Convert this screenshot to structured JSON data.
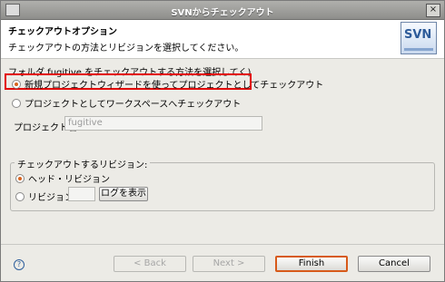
{
  "window": {
    "title": "SVNからチェックアウト",
    "close_glyph": "×"
  },
  "header": {
    "title": "チェックアウトオプション",
    "description": "チェックアウトの方法とリビジョンを選択してください。",
    "logo_text": "SVN"
  },
  "checkout_method": {
    "prompt": "フォルダ fugitive をチェックアウトする方法を選択してく)",
    "options": [
      {
        "label": "新規プロジェクトウィザードを使ってプロジェクトとしてチェックアウト",
        "selected": true
      },
      {
        "label": "プロジェクトとしてワークスペースへチェックアウト",
        "selected": false
      }
    ],
    "project_name_label": "プロジェクト名:",
    "project_name_value": "fugitive"
  },
  "revision": {
    "group_label": "チェックアウトするリビジョン:",
    "options": [
      {
        "label": "ヘッド・リビジョン",
        "selected": true
      },
      {
        "label": "リビジョン",
        "selected": false
      }
    ],
    "revision_value": "",
    "show_log_label": "ログを表示"
  },
  "footer": {
    "help_glyph": "?",
    "back_label": "< Back",
    "next_label": "Next >",
    "finish_label": "Finish",
    "cancel_label": "Cancel"
  },
  "colors": {
    "highlight": "#e20000",
    "radio_accent": "#d8641e",
    "primary_border": "#d75a1a"
  }
}
